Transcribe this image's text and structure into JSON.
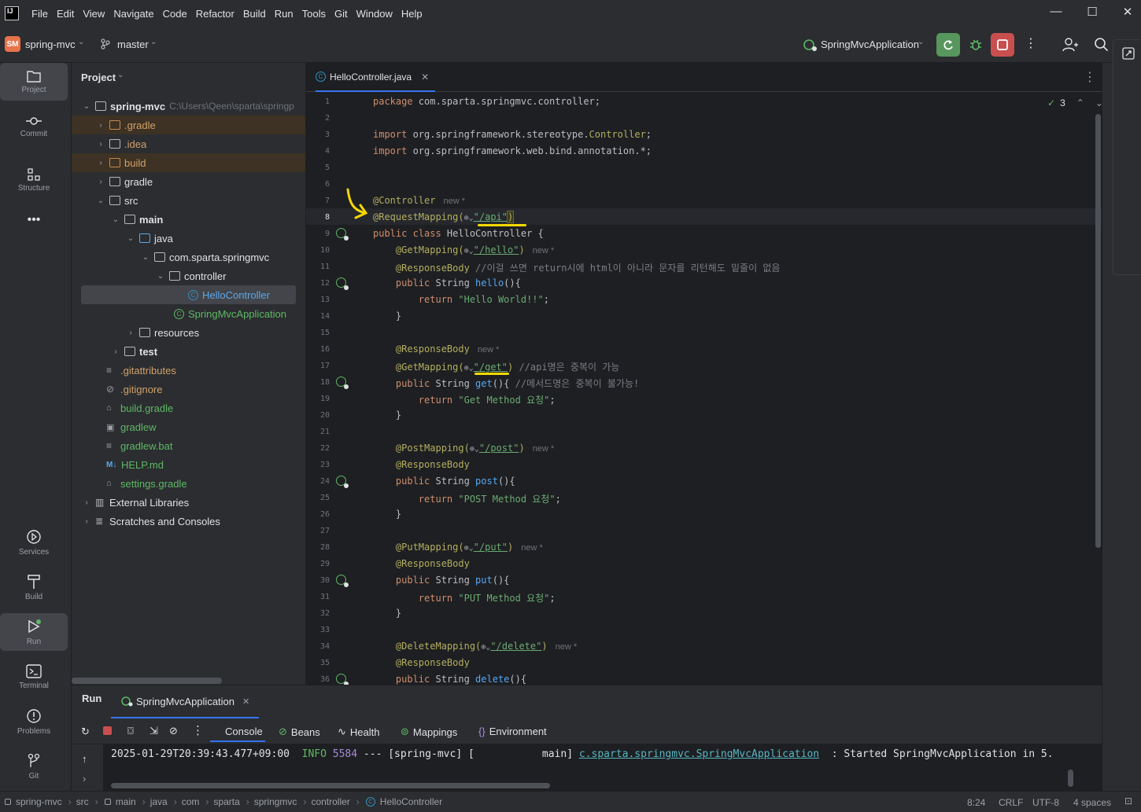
{
  "menu": [
    "File",
    "Edit",
    "View",
    "Navigate",
    "Code",
    "Refactor",
    "Build",
    "Run",
    "Tools",
    "Git",
    "Window",
    "Help"
  ],
  "toolbar": {
    "project_badge": "SM",
    "project_name": "spring-mvc",
    "branch": "master",
    "run_config": "SpringMvcApplication"
  },
  "left_strip": [
    "Project",
    "Commit",
    "Structure",
    "Services",
    "Build",
    "Run",
    "Terminal",
    "Problems",
    "Git"
  ],
  "project_panel": {
    "title": "Project",
    "root_name": "spring-mvc",
    "root_path": "C:\\Users\\Qeen\\sparta\\springp",
    "items": [
      ".gradle",
      ".idea",
      "build",
      "gradle",
      "src",
      "main",
      "java",
      "com.sparta.springmvc",
      "controller",
      "HelloController",
      "SpringMvcApplication",
      "resources",
      "test",
      ".gitattributes",
      ".gitignore",
      "build.gradle",
      "gradlew",
      "gradlew.bat",
      "HELP.md",
      "settings.gradle",
      "External Libraries",
      "Scratches and Consoles"
    ]
  },
  "editor": {
    "tab": "HelloController.java",
    "inspections": "3",
    "line_numbers": [
      "1",
      "2",
      "3",
      "4",
      "5",
      "6",
      "7",
      "8",
      "9",
      "10",
      "11",
      "12",
      "13",
      "14",
      "15",
      "16",
      "17",
      "18",
      "19",
      "20",
      "21",
      "22",
      "23",
      "24",
      "25",
      "26",
      "27",
      "28",
      "29",
      "30",
      "31",
      "32",
      "33",
      "34",
      "35",
      "36"
    ],
    "lines": {
      "l1a": "package",
      "l1b": " com.sparta.springmvc.controller;",
      "l3a": "import",
      "l3b": " org.springframework.stereotype.",
      "l3c": "Controller",
      "l3d": ";",
      "l4a": "import",
      "l4b": " org.springframework.web.bind.annotation.*;",
      "l7": "@Controller",
      "l8a": "@RequestMapping(",
      "l8b": "\"/api\"",
      "l8c": ")",
      "l9a": "public class",
      "l9b": " HelloController {",
      "l10a": "    @GetMapping(",
      "l10b": "\"/hello\"",
      "l10c": ")",
      "l11a": "    @ResponseBody",
      "l11b": " //이걸 쓰면 return시에 html이 아니라 문자를 리턴해도 밑줄이 없음",
      "l12a": "    public",
      "l12b": " String ",
      "l12c": "hello",
      "l12d": "(){",
      "l13a": "        return",
      "l13b": " \"Hello World!!\"",
      "l13c": ";",
      "l14": "    }",
      "l16": "    @ResponseBody",
      "l17a": "    @GetMapping(",
      "l17b": "\"/get\"",
      "l17c": ")",
      "l17d": " //api명은 중복이 가능",
      "l18a": "    public",
      "l18b": " String ",
      "l18c": "get",
      "l18d": "(){",
      "l18e": " //메서드명은 중복이 불가능!",
      "l19a": "        return",
      "l19b": " \"Get Method 요청\"",
      "l19c": ";",
      "l20": "    }",
      "l22a": "    @PostMapping(",
      "l22b": "\"/post\"",
      "l22c": ")",
      "l23": "    @ResponseBody",
      "l24a": "    public",
      "l24b": " String ",
      "l24c": "post",
      "l24d": "(){",
      "l25a": "        return",
      "l25b": " \"POST Method 요청\"",
      "l25c": ";",
      "l26": "    }",
      "l28a": "    @PutMapping(",
      "l28b": "\"/put\"",
      "l28c": ")",
      "l29": "    @ResponseBody",
      "l30a": "    public",
      "l30b": " String ",
      "l30c": "put",
      "l30d": "(){",
      "l31a": "        return",
      "l31b": " \"PUT Method 요청\"",
      "l31c": ";",
      "l32": "    }",
      "l34a": "    @DeleteMapping(",
      "l34b": "\"/delete\"",
      "l34c": ")",
      "l35": "    @ResponseBody",
      "l36a": "    public",
      "l36b": " String ",
      "l36c": "delete",
      "l36d": "(){"
    },
    "hint_new": "new *"
  },
  "run_panel": {
    "title": "Run",
    "config_tab": "SpringMvcApplication",
    "subtabs": [
      "Console",
      "Beans",
      "Health",
      "Mappings",
      "Environment"
    ],
    "log": {
      "time": "2025-01-29T20:39:43.477+09:00",
      "level": "INFO",
      "pid": "5584",
      "mid": " --- [spring-mvc] [           main] ",
      "logger": "c.sparta.springmvc.SpringMvcApplication",
      "msg": "  : Started SpringMvcApplication in 5."
    }
  },
  "status_bar": {
    "crumbs": [
      "spring-mvc",
      "src",
      "main",
      "java",
      "com",
      "sparta",
      "springmvc",
      "controller",
      "HelloController"
    ],
    "position": "8:24",
    "line_sep": "CRLF",
    "encoding": "UTF-8",
    "indent": "4 spaces"
  },
  "colors": {
    "accent": "#3574f0",
    "run_green": "#5fb865",
    "stop_red": "#db5c5c",
    "annotation": "#b3ae60",
    "keyword": "#cf8e6d",
    "string": "#6aab73"
  }
}
